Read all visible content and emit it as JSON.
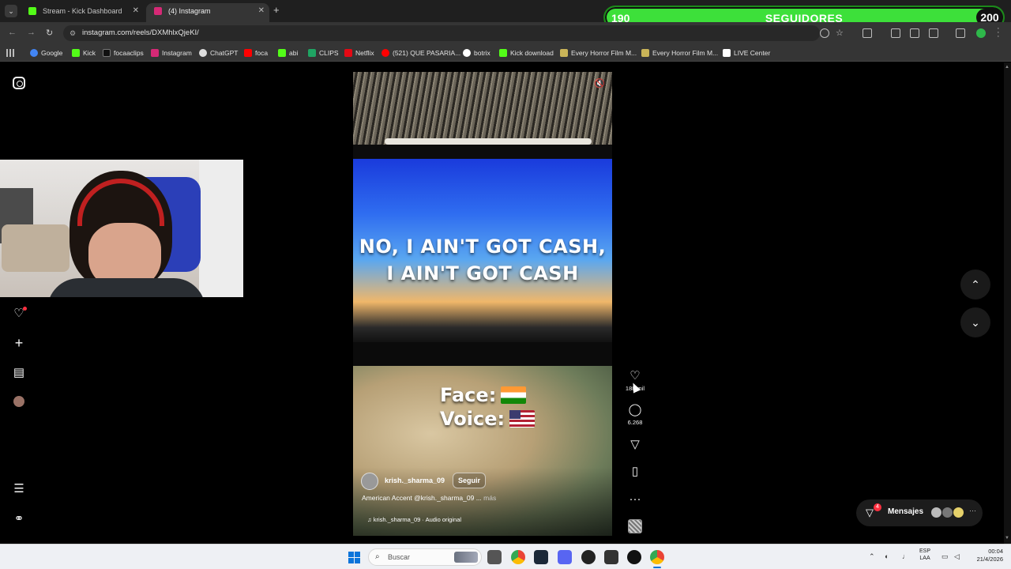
{
  "browser": {
    "tabs": [
      {
        "title": "Stream - Kick Dashboard",
        "favicon_color": "#53fc18",
        "active": false
      },
      {
        "title": "(4) Instagram",
        "favicon_color": "#d62976",
        "active": true
      }
    ],
    "url": "instagram.com/reels/DXMhlxQjeKI/",
    "bookmarks": [
      {
        "label": "Google",
        "color": "#4285f4"
      },
      {
        "label": "Kick",
        "color": "#53fc18"
      },
      {
        "label": "focaaclips",
        "color": "#111111"
      },
      {
        "label": "Instagram",
        "color": "#d62976"
      },
      {
        "label": "ChatGPT",
        "color": "#dddddd"
      },
      {
        "label": "foca",
        "color": "#ff0000"
      },
      {
        "label": "abi",
        "color": "#53fc18"
      },
      {
        "label": "CLIPS",
        "color": "#1fa463"
      },
      {
        "label": "Netflix",
        "color": "#e50914"
      },
      {
        "label": "(521) QUE PASARIA...",
        "color": "#ff0000"
      },
      {
        "label": "botrix",
        "color": "#ffffff"
      },
      {
        "label": "Kick download",
        "color": "#53fc18"
      },
      {
        "label": "Every Horror Film M...",
        "color": "#c9b458"
      },
      {
        "label": "Every Horror Film M...",
        "color": "#c9b458"
      },
      {
        "label": "LIVE Center",
        "color": "#ffffff"
      }
    ]
  },
  "follower_goal": {
    "current": "190",
    "label": "SEGUIDORES",
    "target": "200",
    "color": "#3de03a"
  },
  "reel": {
    "caption_line1": "NO, I AIN'T GOT CASH,",
    "caption_line2": "I AIN'T GOT CASH",
    "face_label": "Face:",
    "voice_label": "Voice:",
    "author": "krish._sharma_09",
    "follow_label": "Seguir",
    "description": "American Accent @krish._sharma_09 ...",
    "more_label": "más",
    "audio": "krish._sharma_09 · Audio original"
  },
  "actions": {
    "likes": "188 mil",
    "comments": "6.268"
  },
  "messages": {
    "label": "Mensajes",
    "badge": "4"
  },
  "taskbar": {
    "search_placeholder": "Buscar",
    "lang_line1": "ESP",
    "lang_line2": "LAA",
    "time": "00:04",
    "date": "21/4/2026"
  },
  "icons": [
    "instagram-logo-icon",
    "heart-icon",
    "plus-icon",
    "insights-icon",
    "menu-icon",
    "threads-icon",
    "mute-icon",
    "comment-icon",
    "share-icon",
    "bookmark-icon",
    "more-icon",
    "chevron-up-icon",
    "chevron-down-icon",
    "messages-icon",
    "windows-icon",
    "search-icon"
  ]
}
